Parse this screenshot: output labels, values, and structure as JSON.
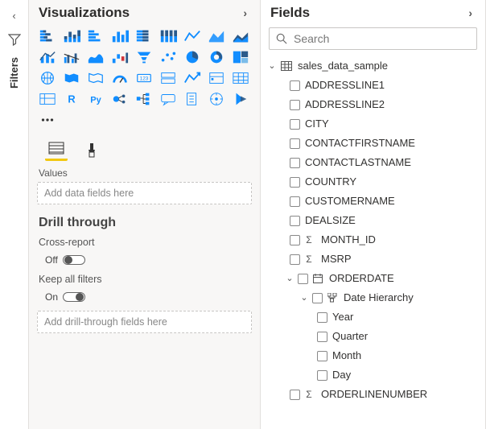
{
  "filtersRail": {
    "label": "Filters"
  },
  "visualizations": {
    "title": "Visualizations",
    "valuesLabel": "Values",
    "valuesPlaceholder": "Add data fields here",
    "drillTitle": "Drill through",
    "crossReportLabel": "Cross-report",
    "crossReportState": "Off",
    "keepFiltersLabel": "Keep all filters",
    "keepFiltersState": "On",
    "drillPlaceholder": "Add drill-through fields here",
    "gallery": [
      "stacked-bar",
      "stacked-column",
      "clustered-bar",
      "clustered-column",
      "100-stacked-bar",
      "100-stacked-column",
      "line",
      "area",
      "stacked-area",
      "line-stacked-column",
      "line-clustered-column",
      "ribbon",
      "waterfall",
      "funnel",
      "scatter",
      "pie",
      "donut",
      "treemap",
      "map",
      "filled-map",
      "shape-map",
      "gauge",
      "card",
      "multi-row-card",
      "kpi",
      "slicer",
      "table",
      "matrix",
      "r-visual",
      "python-visual",
      "key-influencers",
      "decomposition-tree",
      "qa-visual",
      "paginated",
      "arcgis",
      "power-apps",
      "more"
    ]
  },
  "fields": {
    "title": "Fields",
    "searchPlaceholder": "Search",
    "table": "sales_data_sample",
    "cols": [
      {
        "name": "ADDRESSLINE1",
        "kind": "text"
      },
      {
        "name": "ADDRESSLINE2",
        "kind": "text"
      },
      {
        "name": "CITY",
        "kind": "text"
      },
      {
        "name": "CONTACTFIRSTNAME",
        "kind": "text"
      },
      {
        "name": "CONTACTLASTNAME",
        "kind": "text"
      },
      {
        "name": "COUNTRY",
        "kind": "text"
      },
      {
        "name": "CUSTOMERNAME",
        "kind": "text"
      },
      {
        "name": "DEALSIZE",
        "kind": "text"
      },
      {
        "name": "MONTH_ID",
        "kind": "sum"
      },
      {
        "name": "MSRP",
        "kind": "sum"
      }
    ],
    "dateField": "ORDERDATE",
    "dateHierarchy": {
      "label": "Date Hierarchy",
      "levels": [
        "Year",
        "Quarter",
        "Month",
        "Day"
      ]
    },
    "afterDate": [
      {
        "name": "ORDERLINENUMBER",
        "kind": "sum"
      }
    ]
  }
}
